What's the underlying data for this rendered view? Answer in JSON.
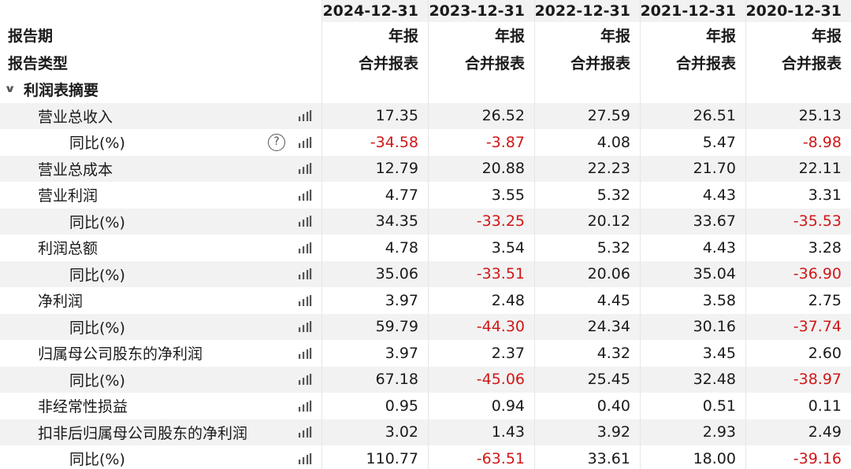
{
  "header": {
    "row1_label": "",
    "row2_label": "报告期",
    "row3_label": "报告类型",
    "periods": [
      {
        "date": "2024-12-31",
        "period": "年报",
        "type": "合并报表"
      },
      {
        "date": "2023-12-31",
        "period": "年报",
        "type": "合并报表"
      },
      {
        "date": "2022-12-31",
        "period": "年报",
        "type": "合并报表"
      },
      {
        "date": "2021-12-31",
        "period": "年报",
        "type": "合并报表"
      },
      {
        "date": "2020-12-31",
        "period": "年报",
        "type": "合并报表"
      }
    ]
  },
  "section": {
    "chevron": "chevron-down-icon",
    "title": "利润表摘要"
  },
  "rows": [
    {
      "label": "营业总收入",
      "indent": 1,
      "help": false,
      "values": [
        "17.35",
        "26.52",
        "27.59",
        "26.51",
        "25.13"
      ],
      "neg": [
        false,
        false,
        false,
        false,
        false
      ]
    },
    {
      "label": "同比(%)",
      "indent": 2,
      "help": true,
      "values": [
        "-34.58",
        "-3.87",
        "4.08",
        "5.47",
        "-8.98"
      ],
      "neg": [
        true,
        true,
        false,
        false,
        true
      ]
    },
    {
      "label": "营业总成本",
      "indent": 1,
      "help": false,
      "values": [
        "12.79",
        "20.88",
        "22.23",
        "21.70",
        "22.11"
      ],
      "neg": [
        false,
        false,
        false,
        false,
        false
      ]
    },
    {
      "label": "营业利润",
      "indent": 1,
      "help": false,
      "values": [
        "4.77",
        "3.55",
        "5.32",
        "4.43",
        "3.31"
      ],
      "neg": [
        false,
        false,
        false,
        false,
        false
      ]
    },
    {
      "label": "同比(%)",
      "indent": 2,
      "help": false,
      "values": [
        "34.35",
        "-33.25",
        "20.12",
        "33.67",
        "-35.53"
      ],
      "neg": [
        false,
        true,
        false,
        false,
        true
      ]
    },
    {
      "label": "利润总额",
      "indent": 1,
      "help": false,
      "values": [
        "4.78",
        "3.54",
        "5.32",
        "4.43",
        "3.28"
      ],
      "neg": [
        false,
        false,
        false,
        false,
        false
      ]
    },
    {
      "label": "同比(%)",
      "indent": 2,
      "help": false,
      "values": [
        "35.06",
        "-33.51",
        "20.06",
        "35.04",
        "-36.90"
      ],
      "neg": [
        false,
        true,
        false,
        false,
        true
      ]
    },
    {
      "label": "净利润",
      "indent": 1,
      "help": false,
      "values": [
        "3.97",
        "2.48",
        "4.45",
        "3.58",
        "2.75"
      ],
      "neg": [
        false,
        false,
        false,
        false,
        false
      ]
    },
    {
      "label": "同比(%)",
      "indent": 2,
      "help": false,
      "values": [
        "59.79",
        "-44.30",
        "24.34",
        "30.16",
        "-37.74"
      ],
      "neg": [
        false,
        true,
        false,
        false,
        true
      ]
    },
    {
      "label": "归属母公司股东的净利润",
      "indent": 1,
      "help": false,
      "values": [
        "3.97",
        "2.37",
        "4.32",
        "3.45",
        "2.60"
      ],
      "neg": [
        false,
        false,
        false,
        false,
        false
      ]
    },
    {
      "label": "同比(%)",
      "indent": 2,
      "help": false,
      "values": [
        "67.18",
        "-45.06",
        "25.45",
        "32.48",
        "-38.97"
      ],
      "neg": [
        false,
        true,
        false,
        false,
        true
      ]
    },
    {
      "label": "非经常性损益",
      "indent": 1,
      "help": false,
      "values": [
        "0.95",
        "0.94",
        "0.40",
        "0.51",
        "0.11"
      ],
      "neg": [
        false,
        false,
        false,
        false,
        false
      ]
    },
    {
      "label": "扣非后归属母公司股东的净利润",
      "indent": 1,
      "help": false,
      "values": [
        "3.02",
        "1.43",
        "3.92",
        "2.93",
        "2.49"
      ],
      "neg": [
        false,
        false,
        false,
        false,
        false
      ]
    },
    {
      "label": "同比(%)",
      "indent": 2,
      "help": false,
      "values": [
        "110.77",
        "-63.51",
        "33.61",
        "18.00",
        "-39.16"
      ],
      "neg": [
        false,
        true,
        false,
        false,
        true
      ]
    }
  ],
  "icons": {
    "chart": "bar-chart-icon",
    "help": "question-icon",
    "help_glyph": "?"
  },
  "colors": {
    "negative": "#d01818",
    "shade": "#f2f2f2",
    "text": "#1a1a1a"
  }
}
